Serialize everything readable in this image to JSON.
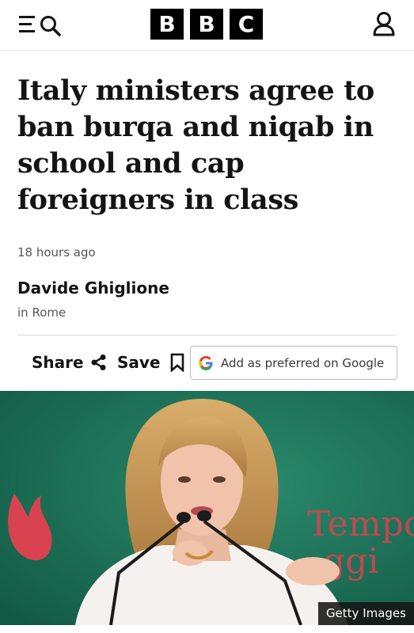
{
  "header": {
    "logo_letters": [
      "B",
      "B",
      "C"
    ],
    "menu_icon": "menu-icon",
    "search_icon": "search-icon",
    "account_icon": "account-icon"
  },
  "article": {
    "headline": "Italy ministers agree to ban burqa and niqab in school and cap foreigners in class",
    "timestamp": "18 hours ago",
    "author": "Davide Ghiglione",
    "location": "in Rome"
  },
  "actions": {
    "share_label": "Share",
    "save_label": "Save",
    "google_label": "Add as preferred on Google",
    "share_icon": "share-icon",
    "save_icon": "bookmark-icon",
    "google_icon": "google-g-icon"
  },
  "image": {
    "credit": "Getty Images",
    "backdrop_text": "Tempo",
    "backdrop_text_2": "ggi"
  },
  "colors": {
    "backdrop_green": "#1f7a60",
    "flame_red": "#d9434f",
    "text_primary": "#141414",
    "text_secondary": "#545658"
  }
}
